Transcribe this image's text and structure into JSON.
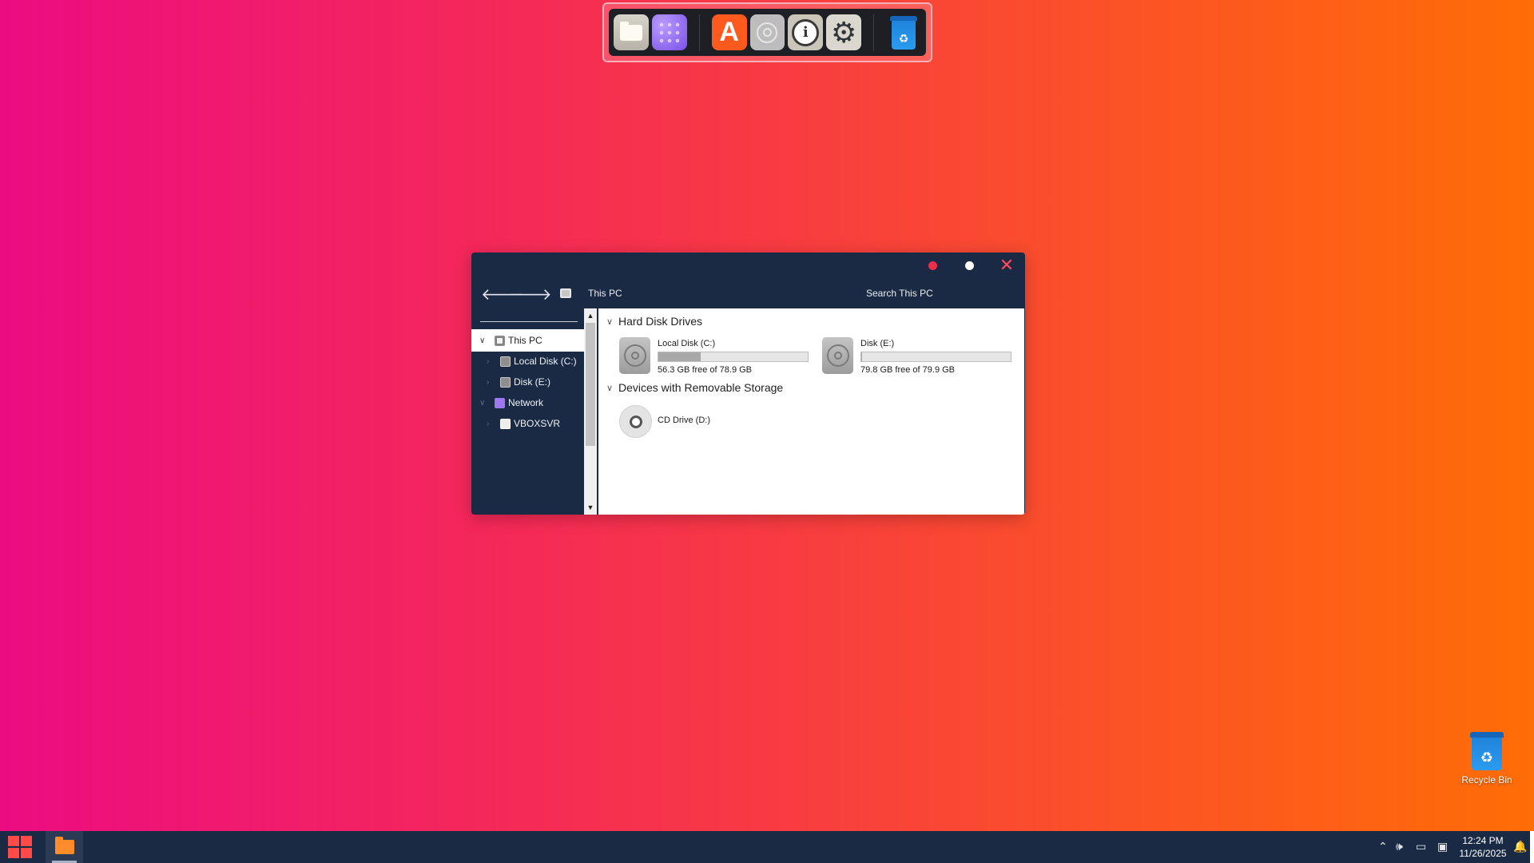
{
  "dock": {
    "items": [
      {
        "name": "files-icon"
      },
      {
        "name": "network-icon"
      },
      {
        "name": "app-store-icon",
        "glyph": "A"
      },
      {
        "name": "disk-icon"
      },
      {
        "name": "system-info-icon",
        "glyph": "i"
      },
      {
        "name": "settings-gear-icon",
        "glyph": "⚙"
      },
      {
        "name": "recycle-bin-icon",
        "glyph": "♻"
      }
    ]
  },
  "window": {
    "address": "This PC",
    "search_placeholder": "Search This PC",
    "nav": {
      "back": "🡐",
      "forward": "🡒"
    },
    "controls": {
      "close": "✕"
    },
    "sidebar": {
      "items": [
        {
          "label": "This PC",
          "chevron": "∨",
          "icon": "pc-icon",
          "selected": true
        },
        {
          "label": "Local Disk (C:)",
          "chevron": "›",
          "icon": "disk-icon"
        },
        {
          "label": "Disk (E:)",
          "chevron": "›",
          "icon": "disk-icon"
        },
        {
          "label": "Network",
          "chevron": "∨",
          "icon": "network-icon"
        },
        {
          "label": "VBOXSVR",
          "chevron": "›",
          "icon": "share-icon"
        }
      ],
      "scroll_up": "▲",
      "scroll_down": "▼"
    },
    "content": {
      "groups": [
        {
          "title": "Hard Disk Drives",
          "chevron": "∨"
        },
        {
          "title": "Devices with Removable Storage",
          "chevron": "∨"
        }
      ],
      "drives": [
        {
          "name": "Local Disk (C:)",
          "free_text": "56.3 GB free of 78.9 GB",
          "used_fraction": 0.286
        },
        {
          "name": "Disk (E:)",
          "free_text": "79.8 GB free of 79.9 GB",
          "used_fraction": 0.001
        }
      ],
      "removable": [
        {
          "name": "CD Drive (D:)"
        }
      ]
    }
  },
  "desktop": {
    "recycle_bin_label": "Recycle Bin",
    "recycle_glyph": "♻"
  },
  "taskbar": {
    "tray": {
      "chevron": "⌃",
      "volume": "🕪",
      "network": "▭",
      "display": "▣",
      "time": "12:24 PM",
      "date": "11/26/2025",
      "bell": "🔔"
    }
  },
  "colors": {
    "accent_close": "#ff4a5a",
    "window_bg": "#1b2a44",
    "start_red": "#ff4a4a"
  }
}
